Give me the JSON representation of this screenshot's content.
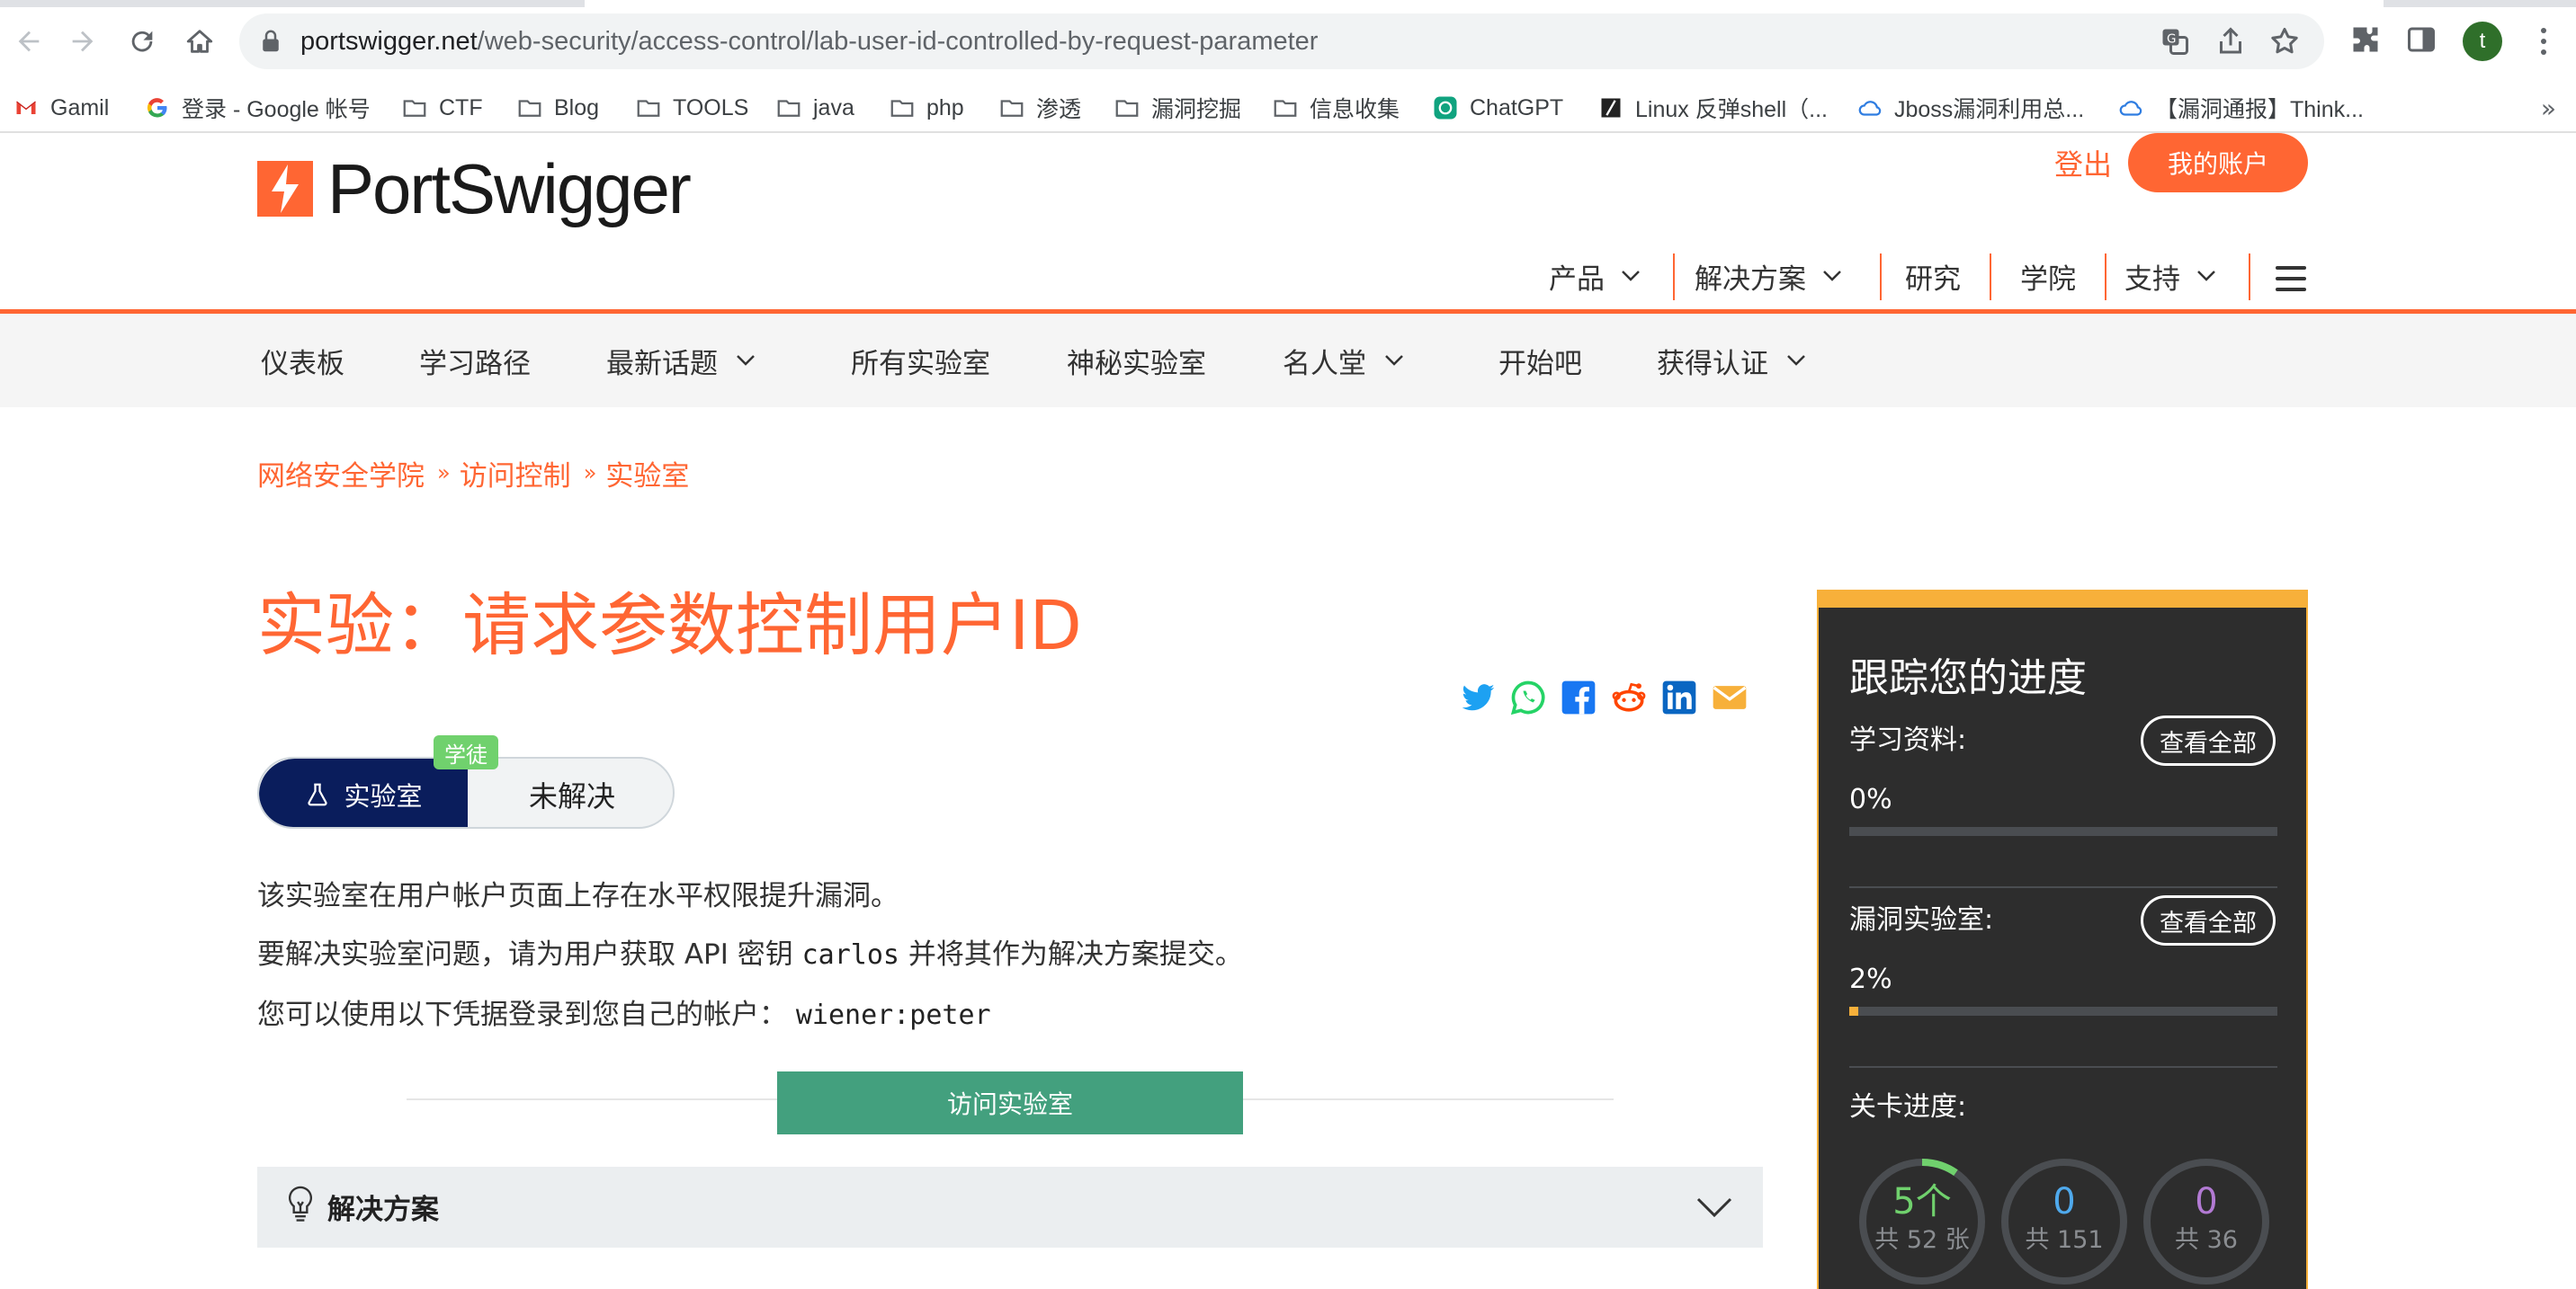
{
  "browser": {
    "url_host": "portswigger.net",
    "url_path": "/web-security/access-control/lab-user-id-controlled-by-request-parameter",
    "profile_initial": "t",
    "bookmarks": [
      {
        "label": "Gamil",
        "icon": "gmail-icon"
      },
      {
        "label": "登录 - Google 帐号",
        "icon": "google-icon"
      },
      {
        "label": "CTF",
        "icon": "folder-icon"
      },
      {
        "label": "Blog",
        "icon": "folder-icon"
      },
      {
        "label": "TOOLS",
        "icon": "folder-icon"
      },
      {
        "label": "java",
        "icon": "folder-icon"
      },
      {
        "label": "php",
        "icon": "folder-icon"
      },
      {
        "label": "渗透",
        "icon": "folder-icon"
      },
      {
        "label": "漏洞挖掘",
        "icon": "folder-icon"
      },
      {
        "label": "信息收集",
        "icon": "folder-icon"
      },
      {
        "label": "ChatGPT",
        "icon": "chatgpt-icon"
      },
      {
        "label": "Linux 反弹shell（...",
        "icon": "bookmark-icon"
      },
      {
        "label": "Jboss漏洞利用总...",
        "icon": "cloud-icon"
      },
      {
        "label": "【漏洞通报】Think...",
        "icon": "cloud-icon"
      }
    ],
    "more_label": "»"
  },
  "header": {
    "logo_text": "PortSwigger",
    "logout_label": "登出",
    "account_label": "我的账户",
    "main_nav": [
      "产品",
      "解决方案",
      "研究",
      "学院",
      "支持"
    ]
  },
  "subnav": [
    "仪表板",
    "学习路径",
    "最新话题",
    "所有实验室",
    "神秘实验室",
    "名人堂",
    "开始吧",
    "获得认证"
  ],
  "breadcrumb": [
    "网络安全学院",
    "访问控制",
    "实验室"
  ],
  "breadcrumb_sep": "»",
  "lab": {
    "title": "实验：请求参数控制用户ID",
    "level": "学徒",
    "badge_lab": "实验室",
    "badge_status": "未解决",
    "p1": "该实验室在用户帐户页面上存在水平权限提升漏洞。",
    "p2_a": "要解决实验室问题，请为用户获取 API 密钥 ",
    "p2_code": "carlos",
    "p2_b": " 并将其作为解决方案提交。",
    "p3_a": "您可以使用以下凭据登录到您自己的帐户：",
    "p3_code": "wiener:peter",
    "access_label": "访问实验室",
    "solution_label": "解决方案"
  },
  "progress": {
    "title": "跟踪您的进度",
    "learning_label": "学习资料:",
    "learning_pct": "0%",
    "learning_value": 0,
    "labs_label": "漏洞实验室:",
    "labs_pct": "2%",
    "labs_value": 0.02,
    "view_all": "查看全部",
    "level_label": "关卡进度:",
    "rings": [
      {
        "count": "5个",
        "total": "共 52 张",
        "color": "#70d16d",
        "fraction": 0.096
      },
      {
        "count": "0",
        "total": "共 151",
        "color": "#4fa9ec",
        "fraction": 0
      },
      {
        "count": "0",
        "total": "共 36",
        "color": "#b27ad3",
        "fraction": 0
      }
    ]
  },
  "colors": {
    "brand": "#ff6633",
    "navy": "#0a1d5c",
    "green_button": "#43a07e",
    "sidebar_bg": "#2d2d2d",
    "sidebar_accent": "#f7b03a"
  }
}
